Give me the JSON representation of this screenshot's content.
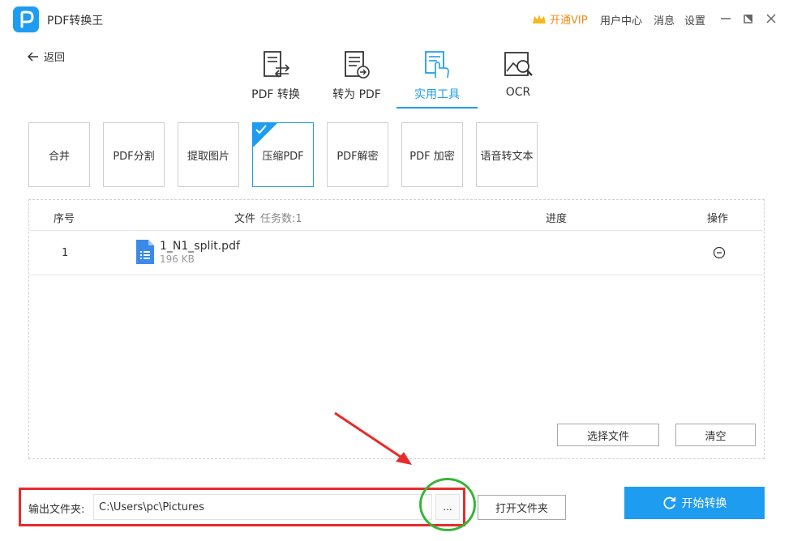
{
  "app": {
    "title": "PDF转换王"
  },
  "topbar": {
    "vip_label": "开通VIP",
    "user_center": "用户中心",
    "messages": "消息",
    "settings": "设置"
  },
  "back_label": "返回",
  "tabs": [
    {
      "label": "PDF 转换",
      "icon": "pdf-convert-icon"
    },
    {
      "label": "转为 PDF",
      "icon": "to-pdf-icon"
    },
    {
      "label": "实用工具",
      "icon": "tools-icon",
      "active": true
    },
    {
      "label": "OCR",
      "icon": "ocr-icon"
    }
  ],
  "tools": [
    {
      "label": "合并"
    },
    {
      "label": "PDF分割"
    },
    {
      "label": "提取图片"
    },
    {
      "label": "压缩PDF",
      "selected": true
    },
    {
      "label": "PDF解密"
    },
    {
      "label": "PDF 加密"
    },
    {
      "label": "语音转文本"
    }
  ],
  "table": {
    "col_index": "序号",
    "col_file": "文件",
    "task_count": "任务数:1",
    "col_progress": "进度",
    "col_action": "操作",
    "rows": [
      {
        "index": "1",
        "name": "1_N1_split.pdf",
        "size": "196 KB"
      }
    ]
  },
  "buttons": {
    "select_files": "选择文件",
    "clear": "清空",
    "browse": "...",
    "open_folder": "打开文件夹",
    "start": "开始转换"
  },
  "output": {
    "label": "输出文件夹:",
    "path": "C:\\Users\\pc\\Pictures"
  },
  "colors": {
    "accent": "#1e9cf0",
    "vip": "#f08c19",
    "annotation_red": "#e62c2c",
    "annotation_green": "#3ab43a"
  }
}
